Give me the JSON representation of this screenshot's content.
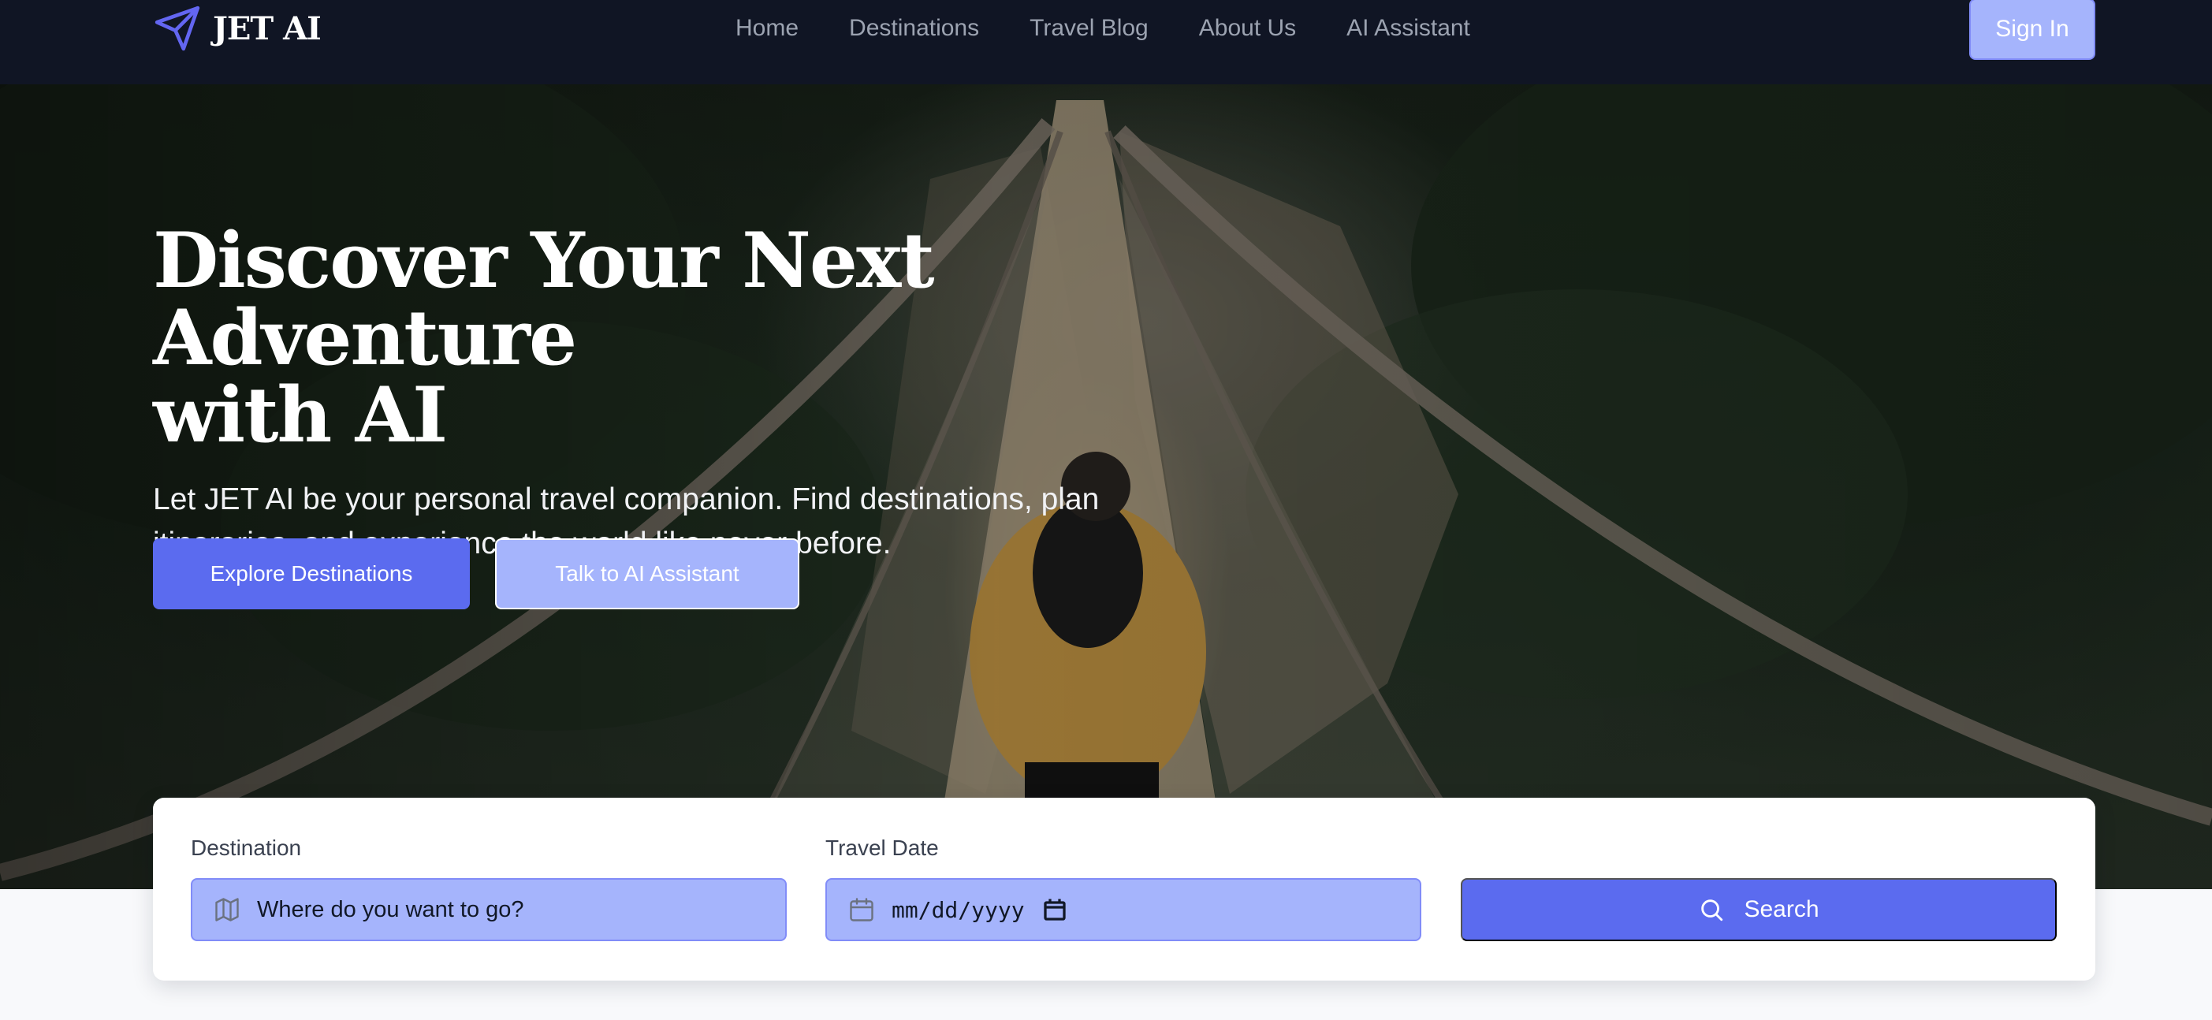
{
  "brand": {
    "name": "JET AI",
    "icon": "paper-plane-icon"
  },
  "nav": {
    "links": [
      {
        "label": "Home"
      },
      {
        "label": "Destinations"
      },
      {
        "label": "Travel Blog"
      },
      {
        "label": "About Us"
      },
      {
        "label": "AI Assistant"
      }
    ],
    "sign_in_label": "Sign In"
  },
  "hero": {
    "title_line1": "Discover Your Next Adventure",
    "title_line2": "with AI",
    "subtitle_line1": "Let JET AI be your personal travel companion. Find destinations, plan",
    "subtitle_line2": "itineraries, and experience the world like never before.",
    "primary_button": "Explore Destinations",
    "secondary_button": "Talk to AI Assistant"
  },
  "search": {
    "destination_label": "Destination",
    "destination_placeholder": "Where do you want to go?",
    "destination_icon": "map-icon",
    "date_label": "Travel Date",
    "date_placeholder": "mm/dd/yyyy",
    "date_icon": "calendar-icon",
    "calendar_picker_icon": "calendar-picker-icon",
    "button_label": "Search",
    "button_icon": "search-icon"
  },
  "colors": {
    "navbar_bg": "#101524",
    "accent": "#5b6bef",
    "accent_light": "#a5b4fc",
    "nav_text": "#9ca3b1"
  }
}
